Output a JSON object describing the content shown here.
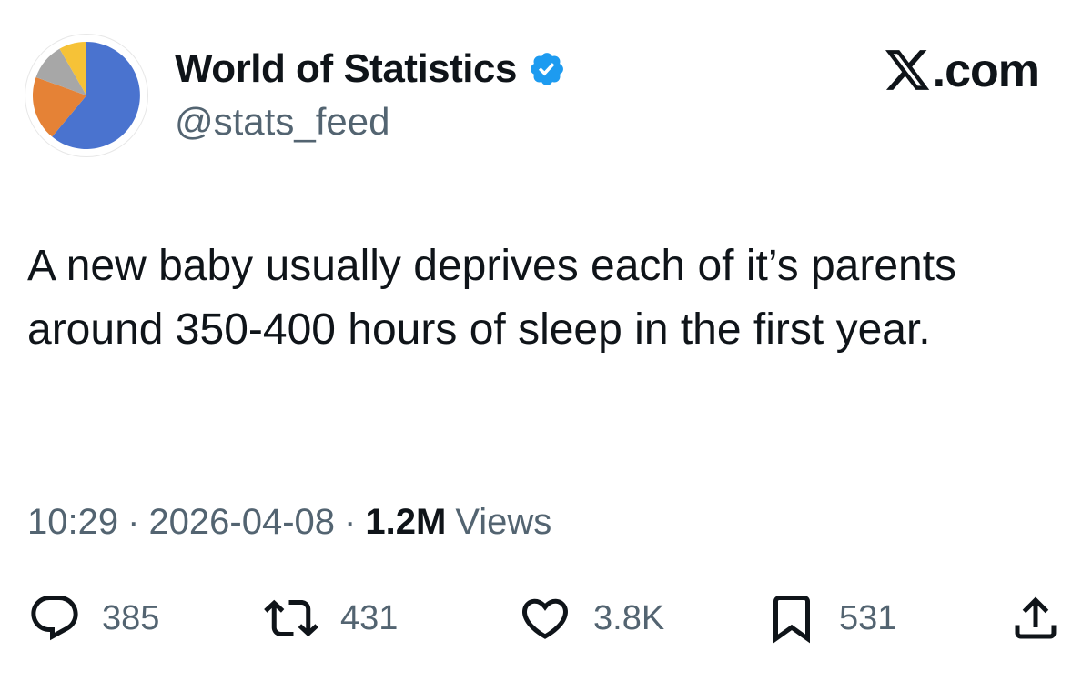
{
  "author": {
    "name": "World of Statistics",
    "handle": "@stats_feed",
    "verified": true,
    "verified_badge_color": "#1d9bf0",
    "avatar_icon": "pie-chart-icon",
    "avatar_colors": [
      "#4a73cf",
      "#e58236",
      "#a7a7a7",
      "#f6c237"
    ]
  },
  "brand": {
    "label": ".com",
    "icon": "x-logo-icon"
  },
  "tweet": {
    "text": "A new baby usually deprives each of it’s parents around 350-400 hours of sleep in the first year."
  },
  "meta": {
    "time": "10:29",
    "separator": "·",
    "date": "2026-04-08",
    "views_count": "1.2M",
    "views_label": "Views"
  },
  "actions": {
    "replies": {
      "icon": "reply-icon",
      "count": "385"
    },
    "reposts": {
      "icon": "repost-icon",
      "count": "431"
    },
    "likes": {
      "icon": "heart-icon",
      "count": "3.8K"
    },
    "bookmarks": {
      "icon": "bookmark-icon",
      "count": "531"
    },
    "share": {
      "icon": "share-icon"
    }
  },
  "colors": {
    "text_primary": "#0f1419",
    "text_secondary": "#536471"
  }
}
